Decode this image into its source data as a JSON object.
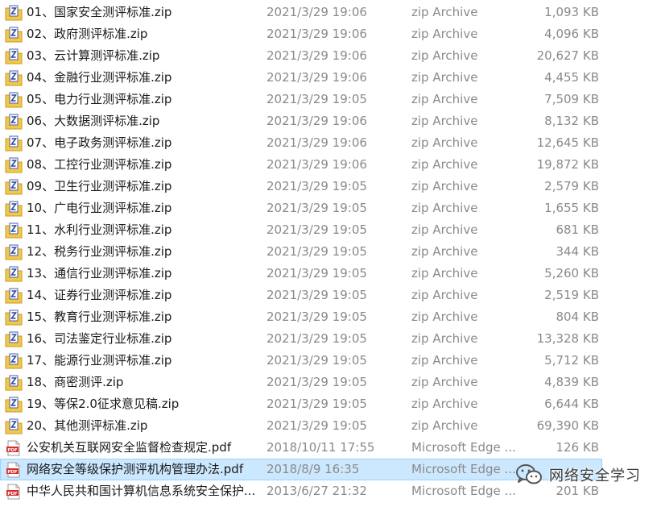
{
  "files": [
    {
      "name": "01、国家安全测评标准.zip",
      "date": "2021/3/29 19:06",
      "type": "zip Archive",
      "size": "1,093 KB",
      "icon": "zip-archive-icon"
    },
    {
      "name": "02、政府测评标准.zip",
      "date": "2021/3/29 19:06",
      "type": "zip Archive",
      "size": "4,096 KB",
      "icon": "zip-archive-icon"
    },
    {
      "name": "03、云计算测评标准.zip",
      "date": "2021/3/29 19:06",
      "type": "zip Archive",
      "size": "20,627 KB",
      "icon": "zip-archive-icon"
    },
    {
      "name": "04、金融行业测评标准.zip",
      "date": "2021/3/29 19:06",
      "type": "zip Archive",
      "size": "4,455 KB",
      "icon": "zip-archive-icon"
    },
    {
      "name": "05、电力行业测评标准.zip",
      "date": "2021/3/29 19:05",
      "type": "zip Archive",
      "size": "7,509 KB",
      "icon": "zip-archive-icon"
    },
    {
      "name": "06、大数据测评标准.zip",
      "date": "2021/3/29 19:06",
      "type": "zip Archive",
      "size": "8,132 KB",
      "icon": "zip-archive-icon"
    },
    {
      "name": "07、电子政务测评标准.zip",
      "date": "2021/3/29 19:06",
      "type": "zip Archive",
      "size": "12,645 KB",
      "icon": "zip-archive-icon"
    },
    {
      "name": "08、工控行业测评标准.zip",
      "date": "2021/3/29 19:06",
      "type": "zip Archive",
      "size": "19,872 KB",
      "icon": "zip-archive-icon"
    },
    {
      "name": "09、卫生行业测评标准.zip",
      "date": "2021/3/29 19:05",
      "type": "zip Archive",
      "size": "2,579 KB",
      "icon": "zip-archive-icon"
    },
    {
      "name": "10、广电行业测评标准.zip",
      "date": "2021/3/29 19:05",
      "type": "zip Archive",
      "size": "1,655 KB",
      "icon": "zip-archive-icon"
    },
    {
      "name": "11、水利行业测评标准.zip",
      "date": "2021/3/29 19:05",
      "type": "zip Archive",
      "size": "681 KB",
      "icon": "zip-archive-icon"
    },
    {
      "name": "12、税务行业测评标准.zip",
      "date": "2021/3/29 19:05",
      "type": "zip Archive",
      "size": "344 KB",
      "icon": "zip-archive-icon"
    },
    {
      "name": "13、通信行业测评标准.zip",
      "date": "2021/3/29 19:05",
      "type": "zip Archive",
      "size": "5,260 KB",
      "icon": "zip-archive-icon"
    },
    {
      "name": "14、证券行业测评标准.zip",
      "date": "2021/3/29 19:05",
      "type": "zip Archive",
      "size": "2,519 KB",
      "icon": "zip-archive-icon"
    },
    {
      "name": "15、教育行业测评标准.zip",
      "date": "2021/3/29 19:05",
      "type": "zip Archive",
      "size": "804 KB",
      "icon": "zip-archive-icon"
    },
    {
      "name": "16、司法鉴定行业标准.zip",
      "date": "2021/3/29 19:05",
      "type": "zip Archive",
      "size": "13,328 KB",
      "icon": "zip-archive-icon"
    },
    {
      "name": "17、能源行业测评标准.zip",
      "date": "2021/3/29 19:05",
      "type": "zip Archive",
      "size": "5,712 KB",
      "icon": "zip-archive-icon"
    },
    {
      "name": "18、商密测评.zip",
      "date": "2021/3/29 19:05",
      "type": "zip Archive",
      "size": "4,839 KB",
      "icon": "zip-archive-icon"
    },
    {
      "name": "19、等保2.0征求意见稿.zip",
      "date": "2021/3/29 19:05",
      "type": "zip Archive",
      "size": "6,644 KB",
      "icon": "zip-archive-icon"
    },
    {
      "name": "20、其他测评标准.zip",
      "date": "2021/3/29 19:05",
      "type": "zip Archive",
      "size": "69,390 KB",
      "icon": "zip-archive-icon"
    },
    {
      "name": "公安机关互联网安全监督检查规定.pdf",
      "date": "2018/10/11 17:55",
      "type": "Microsoft Edge ...",
      "size": "126 KB",
      "icon": "pdf-file-icon"
    },
    {
      "name": "网络安全等级保护测评机构管理办法.pdf",
      "date": "2018/8/9 16:35",
      "type": "Microsoft Edge ...",
      "size": "",
      "icon": "pdf-file-icon",
      "selected": true
    },
    {
      "name": "中华人民共和国计算机信息系统安全保护...",
      "date": "2013/6/27 21:32",
      "type": "Microsoft Edge ...",
      "size": "201 KB",
      "icon": "pdf-file-icon"
    }
  ],
  "watermark": {
    "text": "网络安全学习",
    "icon": "wechat-icon"
  },
  "colors": {
    "selection_bg": "#cce8ff",
    "selection_border": "#99d1ff",
    "secondary_text": "#8a8a8a",
    "pdf_red": "#d32f2f",
    "zip_yellow": "#f2c84b"
  }
}
